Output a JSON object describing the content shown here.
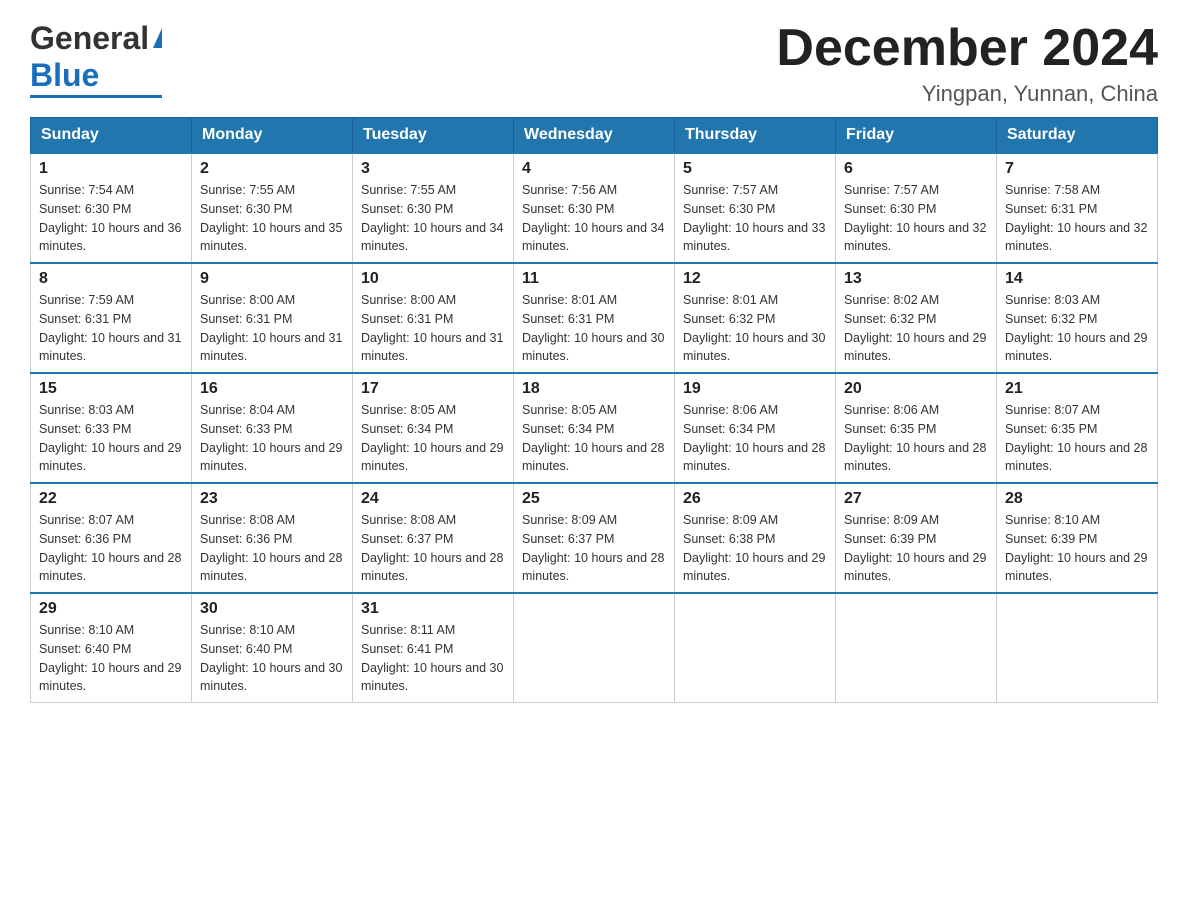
{
  "logo": {
    "general": "General",
    "blue": "Blue"
  },
  "title": "December 2024",
  "location": "Yingpan, Yunnan, China",
  "days_of_week": [
    "Sunday",
    "Monday",
    "Tuesday",
    "Wednesday",
    "Thursday",
    "Friday",
    "Saturday"
  ],
  "weeks": [
    [
      {
        "day": 1,
        "sunrise": "7:54 AM",
        "sunset": "6:30 PM",
        "daylight": "10 hours and 36 minutes."
      },
      {
        "day": 2,
        "sunrise": "7:55 AM",
        "sunset": "6:30 PM",
        "daylight": "10 hours and 35 minutes."
      },
      {
        "day": 3,
        "sunrise": "7:55 AM",
        "sunset": "6:30 PM",
        "daylight": "10 hours and 34 minutes."
      },
      {
        "day": 4,
        "sunrise": "7:56 AM",
        "sunset": "6:30 PM",
        "daylight": "10 hours and 34 minutes."
      },
      {
        "day": 5,
        "sunrise": "7:57 AM",
        "sunset": "6:30 PM",
        "daylight": "10 hours and 33 minutes."
      },
      {
        "day": 6,
        "sunrise": "7:57 AM",
        "sunset": "6:30 PM",
        "daylight": "10 hours and 32 minutes."
      },
      {
        "day": 7,
        "sunrise": "7:58 AM",
        "sunset": "6:31 PM",
        "daylight": "10 hours and 32 minutes."
      }
    ],
    [
      {
        "day": 8,
        "sunrise": "7:59 AM",
        "sunset": "6:31 PM",
        "daylight": "10 hours and 31 minutes."
      },
      {
        "day": 9,
        "sunrise": "8:00 AM",
        "sunset": "6:31 PM",
        "daylight": "10 hours and 31 minutes."
      },
      {
        "day": 10,
        "sunrise": "8:00 AM",
        "sunset": "6:31 PM",
        "daylight": "10 hours and 31 minutes."
      },
      {
        "day": 11,
        "sunrise": "8:01 AM",
        "sunset": "6:31 PM",
        "daylight": "10 hours and 30 minutes."
      },
      {
        "day": 12,
        "sunrise": "8:01 AM",
        "sunset": "6:32 PM",
        "daylight": "10 hours and 30 minutes."
      },
      {
        "day": 13,
        "sunrise": "8:02 AM",
        "sunset": "6:32 PM",
        "daylight": "10 hours and 29 minutes."
      },
      {
        "day": 14,
        "sunrise": "8:03 AM",
        "sunset": "6:32 PM",
        "daylight": "10 hours and 29 minutes."
      }
    ],
    [
      {
        "day": 15,
        "sunrise": "8:03 AM",
        "sunset": "6:33 PM",
        "daylight": "10 hours and 29 minutes."
      },
      {
        "day": 16,
        "sunrise": "8:04 AM",
        "sunset": "6:33 PM",
        "daylight": "10 hours and 29 minutes."
      },
      {
        "day": 17,
        "sunrise": "8:05 AM",
        "sunset": "6:34 PM",
        "daylight": "10 hours and 29 minutes."
      },
      {
        "day": 18,
        "sunrise": "8:05 AM",
        "sunset": "6:34 PM",
        "daylight": "10 hours and 28 minutes."
      },
      {
        "day": 19,
        "sunrise": "8:06 AM",
        "sunset": "6:34 PM",
        "daylight": "10 hours and 28 minutes."
      },
      {
        "day": 20,
        "sunrise": "8:06 AM",
        "sunset": "6:35 PM",
        "daylight": "10 hours and 28 minutes."
      },
      {
        "day": 21,
        "sunrise": "8:07 AM",
        "sunset": "6:35 PM",
        "daylight": "10 hours and 28 minutes."
      }
    ],
    [
      {
        "day": 22,
        "sunrise": "8:07 AM",
        "sunset": "6:36 PM",
        "daylight": "10 hours and 28 minutes."
      },
      {
        "day": 23,
        "sunrise": "8:08 AM",
        "sunset": "6:36 PM",
        "daylight": "10 hours and 28 minutes."
      },
      {
        "day": 24,
        "sunrise": "8:08 AM",
        "sunset": "6:37 PM",
        "daylight": "10 hours and 28 minutes."
      },
      {
        "day": 25,
        "sunrise": "8:09 AM",
        "sunset": "6:37 PM",
        "daylight": "10 hours and 28 minutes."
      },
      {
        "day": 26,
        "sunrise": "8:09 AM",
        "sunset": "6:38 PM",
        "daylight": "10 hours and 29 minutes."
      },
      {
        "day": 27,
        "sunrise": "8:09 AM",
        "sunset": "6:39 PM",
        "daylight": "10 hours and 29 minutes."
      },
      {
        "day": 28,
        "sunrise": "8:10 AM",
        "sunset": "6:39 PM",
        "daylight": "10 hours and 29 minutes."
      }
    ],
    [
      {
        "day": 29,
        "sunrise": "8:10 AM",
        "sunset": "6:40 PM",
        "daylight": "10 hours and 29 minutes."
      },
      {
        "day": 30,
        "sunrise": "8:10 AM",
        "sunset": "6:40 PM",
        "daylight": "10 hours and 30 minutes."
      },
      {
        "day": 31,
        "sunrise": "8:11 AM",
        "sunset": "6:41 PM",
        "daylight": "10 hours and 30 minutes."
      },
      null,
      null,
      null,
      null
    ]
  ]
}
